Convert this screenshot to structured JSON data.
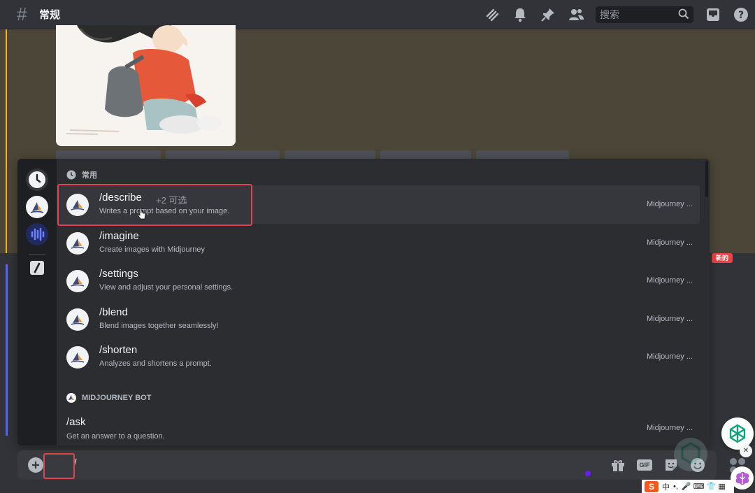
{
  "header": {
    "channel_name": "常规",
    "search_placeholder": "搜索",
    "icons": [
      "threads-icon",
      "bell-icon",
      "pin-icon",
      "members-icon",
      "search-icon",
      "inbox-icon",
      "help-icon"
    ]
  },
  "messages": {
    "new_badge": "新的"
  },
  "popup": {
    "section_frequent": "常用",
    "section_bot": "MIDJOURNEY BOT",
    "commands": [
      {
        "name": "/describe",
        "extra": "+2 可选",
        "desc": "Writes a prompt based on your image.",
        "app": "Midjourney ..."
      },
      {
        "name": "/imagine",
        "extra": "",
        "desc": "Create images with Midjourney",
        "app": "Midjourney ..."
      },
      {
        "name": "/settings",
        "extra": "",
        "desc": "View and adjust your personal settings.",
        "app": "Midjourney ..."
      },
      {
        "name": "/blend",
        "extra": "",
        "desc": "Blend images together seamlessly!",
        "app": "Midjourney ..."
      },
      {
        "name": "/shorten",
        "extra": "",
        "desc": "Analyzes and shortens a prompt.",
        "app": "Midjourney ..."
      }
    ],
    "bot_commands": [
      {
        "name": "/ask",
        "desc": "Get an answer to a question.",
        "app": "Midjourney ..."
      }
    ]
  },
  "composer": {
    "input_value": "/",
    "gif_label": "GIF"
  },
  "overlay": {
    "close_label": "✕",
    "ime_logo": "S",
    "ime_mode": "中",
    "ime_punct": "•,",
    "ime_symbols": "🎤 ⌨ 👕 ▦"
  },
  "colors": {
    "accent": "#5865f2",
    "highlight": "#e0444f",
    "gold": "#f0b232",
    "assistant": "#10a37f"
  }
}
